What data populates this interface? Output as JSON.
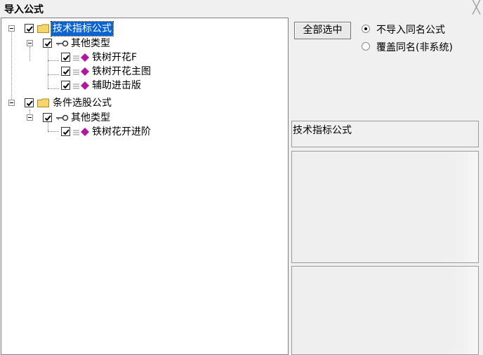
{
  "window": {
    "title": "导入公式",
    "close_glyph": "╳"
  },
  "tree": {
    "nodes": [
      {
        "label": "技术指标公式",
        "selected": true
      },
      {
        "label": "其他类型"
      },
      {
        "label": "铁树开花F"
      },
      {
        "label": "铁树开花主图"
      },
      {
        "label": "辅助进击版"
      },
      {
        "label": "条件选股公式"
      },
      {
        "label": "其他类型"
      },
      {
        "label": "铁树花开进阶"
      }
    ]
  },
  "controls": {
    "select_all_label": "全部选中",
    "radio_no_import_label": "不导入同名公式",
    "radio_overwrite_label": "覆盖同名(非系统)",
    "radio_selected": "no_import"
  },
  "info_panel": {
    "title": "技术指标公式"
  },
  "colors": {
    "selection": "#0a64d2",
    "gem": "#b0179e",
    "folder": "#f6d66b"
  }
}
